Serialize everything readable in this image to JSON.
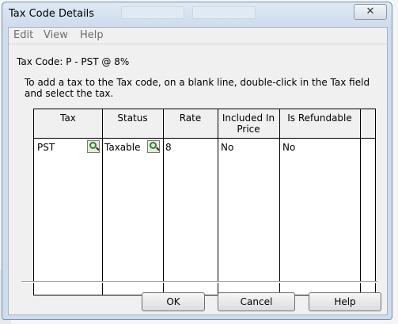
{
  "window": {
    "title": "Tax Code Details",
    "close_glyph": "✕"
  },
  "menu": {
    "items": [
      "Edit",
      "View",
      "Help"
    ]
  },
  "tax_code_line": "Tax Code: P - PST @ 8%",
  "instructions": "To add a tax to the Tax code, on a blank line, double-click in the Tax field and select the tax.",
  "grid": {
    "headers": {
      "tax": "Tax",
      "status": "Status",
      "rate": "Rate",
      "included_in_price": "Included In Price",
      "is_refundable": "Is Refundable"
    },
    "rows": [
      {
        "tax": "PST",
        "status": "Taxable",
        "rate": "8",
        "included_in_price": "No",
        "is_refundable": "No"
      }
    ]
  },
  "buttons": {
    "ok": "OK",
    "cancel": "Cancel",
    "help": "Help"
  },
  "icons": {
    "lookup": "magnifier-lookup-icon",
    "close": "close-icon"
  }
}
